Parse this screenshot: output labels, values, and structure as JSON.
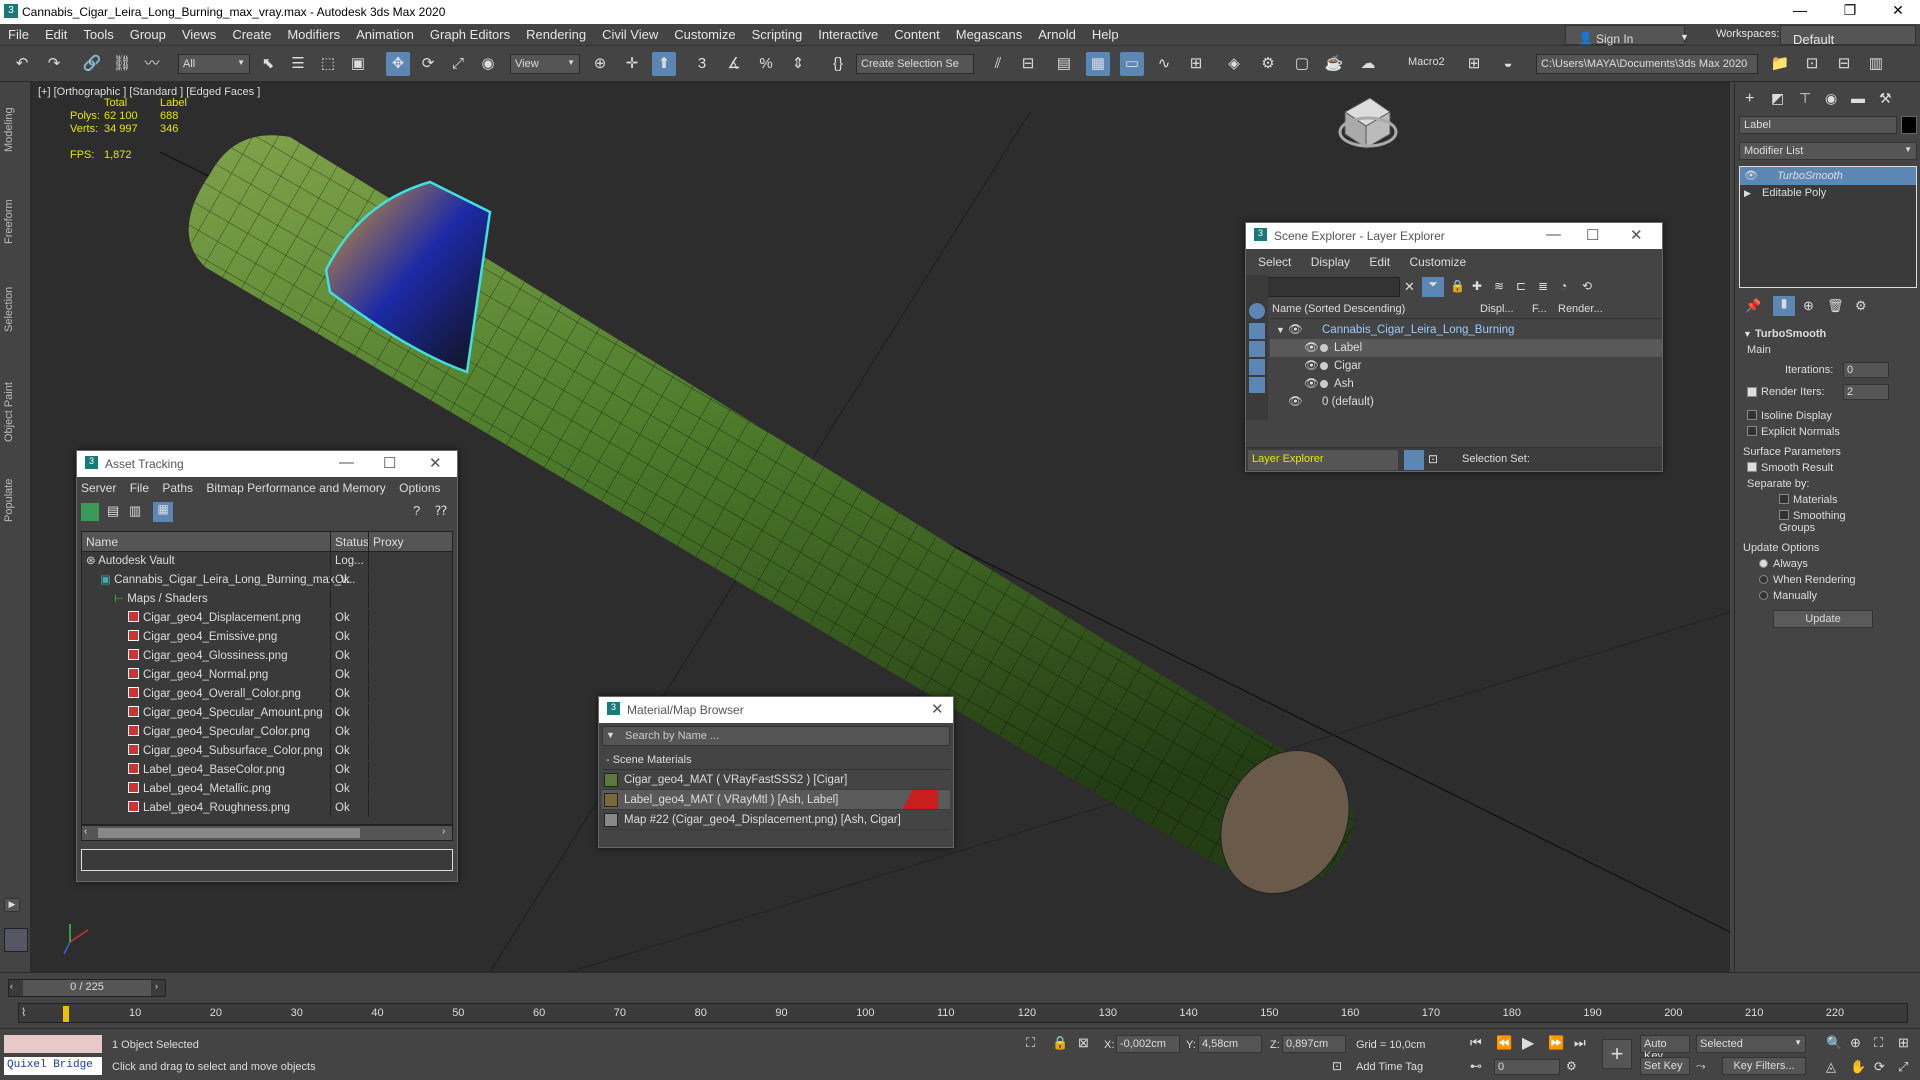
{
  "window": {
    "title": "Cannabis_Cigar_Leira_Long_Burning_max_vray.max - Autodesk 3ds Max 2020"
  },
  "menu": [
    "File",
    "Edit",
    "Tools",
    "Group",
    "Views",
    "Create",
    "Modifiers",
    "Animation",
    "Graph Editors",
    "Rendering",
    "Civil View",
    "Customize",
    "Scripting",
    "Interactive",
    "Content",
    "Megascans",
    "Arnold",
    "Help"
  ],
  "account": {
    "signin": "Sign In",
    "workspaces_label": "Workspaces:",
    "workspace": "Default"
  },
  "toolbar": {
    "filter": "All",
    "view": "View",
    "selection_set": "Create Selection Se",
    "macro": "Macro2",
    "path": "C:\\Users\\MAYA\\Documents\\3ds Max 2020"
  },
  "left_tabs": [
    "Modeling",
    "Freeform",
    "Selection",
    "Object Paint",
    "Populate"
  ],
  "viewport": {
    "label": "[+] [Orthographic ] [Standard ] [Edged Faces ]",
    "stats": {
      "col_total": "Total",
      "col_label": "Label",
      "polys_label": "Polys:",
      "polys_total": "62 100",
      "polys_sel": "688",
      "verts_label": "Verts:",
      "verts_total": "34 997",
      "verts_sel": "346",
      "fps_label": "FPS:",
      "fps": "1,872"
    }
  },
  "scene_explorer": {
    "title": "Scene Explorer - Layer Explorer",
    "menu": [
      "Select",
      "Display",
      "Edit",
      "Customize"
    ],
    "col_name": "Name (Sorted Descending)",
    "col_display": "Displ...",
    "col_f": "F...",
    "col_render": "Render...",
    "rows": [
      {
        "name": "Cannabis_Cigar_Leira_Long_Burning",
        "level": 0
      },
      {
        "name": "Label",
        "level": 1
      },
      {
        "name": "Cigar",
        "level": 1
      },
      {
        "name": "Ash",
        "level": 1
      },
      {
        "name": "0 (default)",
        "level": 0
      }
    ],
    "footer_mode": "Layer Explorer",
    "selection_set_label": "Selection Set:"
  },
  "asset_tracking": {
    "title": "Asset Tracking",
    "menu": [
      "Server",
      "File",
      "Paths",
      "Bitmap Performance and Memory",
      "Options"
    ],
    "col_name": "Name",
    "col_status": "Status",
    "col_proxy": "Proxy",
    "rows": [
      {
        "name": "Autodesk Vault",
        "status": "Log...",
        "indent": 0,
        "kind": "vault"
      },
      {
        "name": "Cannabis_Cigar_Leira_Long_Burning_max_v...",
        "status": "Ok",
        "indent": 1,
        "kind": "max"
      },
      {
        "name": "Maps / Shaders",
        "status": "",
        "indent": 2,
        "kind": "folder"
      },
      {
        "name": "Cigar_geo4_Displacement.png",
        "status": "Ok",
        "indent": 3,
        "kind": "png"
      },
      {
        "name": "Cigar_geo4_Emissive.png",
        "status": "Ok",
        "indent": 3,
        "kind": "png"
      },
      {
        "name": "Cigar_geo4_Glossiness.png",
        "status": "Ok",
        "indent": 3,
        "kind": "png"
      },
      {
        "name": "Cigar_geo4_Normal.png",
        "status": "Ok",
        "indent": 3,
        "kind": "png"
      },
      {
        "name": "Cigar_geo4_Overall_Color.png",
        "status": "Ok",
        "indent": 3,
        "kind": "png"
      },
      {
        "name": "Cigar_geo4_Specular_Amount.png",
        "status": "Ok",
        "indent": 3,
        "kind": "png"
      },
      {
        "name": "Cigar_geo4_Specular_Color.png",
        "status": "Ok",
        "indent": 3,
        "kind": "png"
      },
      {
        "name": "Cigar_geo4_Subsurface_Color.png",
        "status": "Ok",
        "indent": 3,
        "kind": "png"
      },
      {
        "name": "Label_geo4_BaseColor.png",
        "status": "Ok",
        "indent": 3,
        "kind": "png"
      },
      {
        "name": "Label_geo4_Metallic.png",
        "status": "Ok",
        "indent": 3,
        "kind": "png"
      },
      {
        "name": "Label_geo4_Roughness.png",
        "status": "Ok",
        "indent": 3,
        "kind": "png"
      }
    ]
  },
  "material_browser": {
    "title": "Material/Map Browser",
    "search_placeholder": "Search by Name ...",
    "group": "- Scene Materials",
    "items": [
      "Cigar_geo4_MAT  ( VRayFastSSS2 )  [Cigar]",
      "Label_geo4_MAT  ( VRayMtl )  [Ash, Label]",
      "Map #22 (Cigar_geo4_Displacement.png)  [Ash, Cigar]"
    ]
  },
  "command_panel": {
    "object_name": "Label",
    "modifier_list": "Modifier List",
    "stack": [
      "TurboSmooth",
      "Editable Poly"
    ],
    "rollout": "TurboSmooth",
    "main": "Main",
    "iterations_label": "Iterations:",
    "iterations": "0",
    "render_iters_label": "Render Iters:",
    "render_iters": "2",
    "isoline": "Isoline Display",
    "explicit": "Explicit Normals",
    "surface": "Surface Parameters",
    "smooth_result": "Smooth Result",
    "separate_by": "Separate by:",
    "materials": "Materials",
    "smoothing_groups": "Smoothing Groups",
    "update_options": "Update Options",
    "always": "Always",
    "when_rendering": "When Rendering",
    "manually": "Manually",
    "update": "Update"
  },
  "timeline": {
    "frame": "0 / 225",
    "ticks": [
      "10",
      "20",
      "30",
      "40",
      "50",
      "60",
      "70",
      "80",
      "90",
      "100",
      "110",
      "120",
      "130",
      "140",
      "150",
      "160",
      "170",
      "180",
      "190",
      "200",
      "210",
      "220"
    ]
  },
  "status": {
    "quixel": "Quixel Bridge",
    "selected": "1 Object Selected",
    "prompt": "Click and drag to select and move objects",
    "x_label": "X:",
    "x": "-0,002cm",
    "y_label": "Y:",
    "y": "4,58cm",
    "z_label": "Z:",
    "z": "0,897cm",
    "grid": "Grid = 10,0cm",
    "add_time_tag": "Add Time Tag",
    "auto_key": "Auto Key",
    "set_key": "Set Key",
    "selected_dd": "Selected",
    "key_filters": "Key Filters...",
    "frame_field": "0"
  }
}
